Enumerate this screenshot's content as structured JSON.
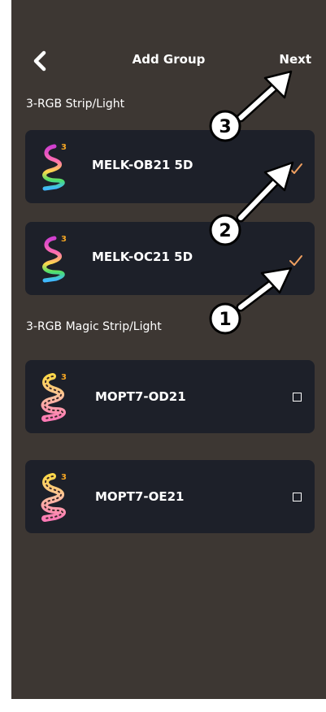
{
  "header": {
    "back_icon": "chevron-left-icon",
    "title": "Add Group",
    "next_label": "Next"
  },
  "sections": [
    {
      "label": "3-RGB Strip/Light",
      "devices": [
        {
          "name": "MELK-OB21 5D",
          "selected": true,
          "badge": "3"
        },
        {
          "name": "MELK-OC21 5D",
          "selected": true,
          "badge": "3"
        }
      ]
    },
    {
      "label": "3-RGB Magic Strip/Light",
      "devices": [
        {
          "name": "MOPT7-OD21",
          "selected": false,
          "badge": "3"
        },
        {
          "name": "MOPT7-OE21",
          "selected": false,
          "badge": "3"
        }
      ]
    }
  ],
  "annotations": [
    {
      "number": "1"
    },
    {
      "number": "2"
    },
    {
      "number": "3"
    }
  ],
  "colors": {
    "background": "#3d3733",
    "card": "#1d2029",
    "check": "#f0a060",
    "badge": "#f5a623"
  }
}
